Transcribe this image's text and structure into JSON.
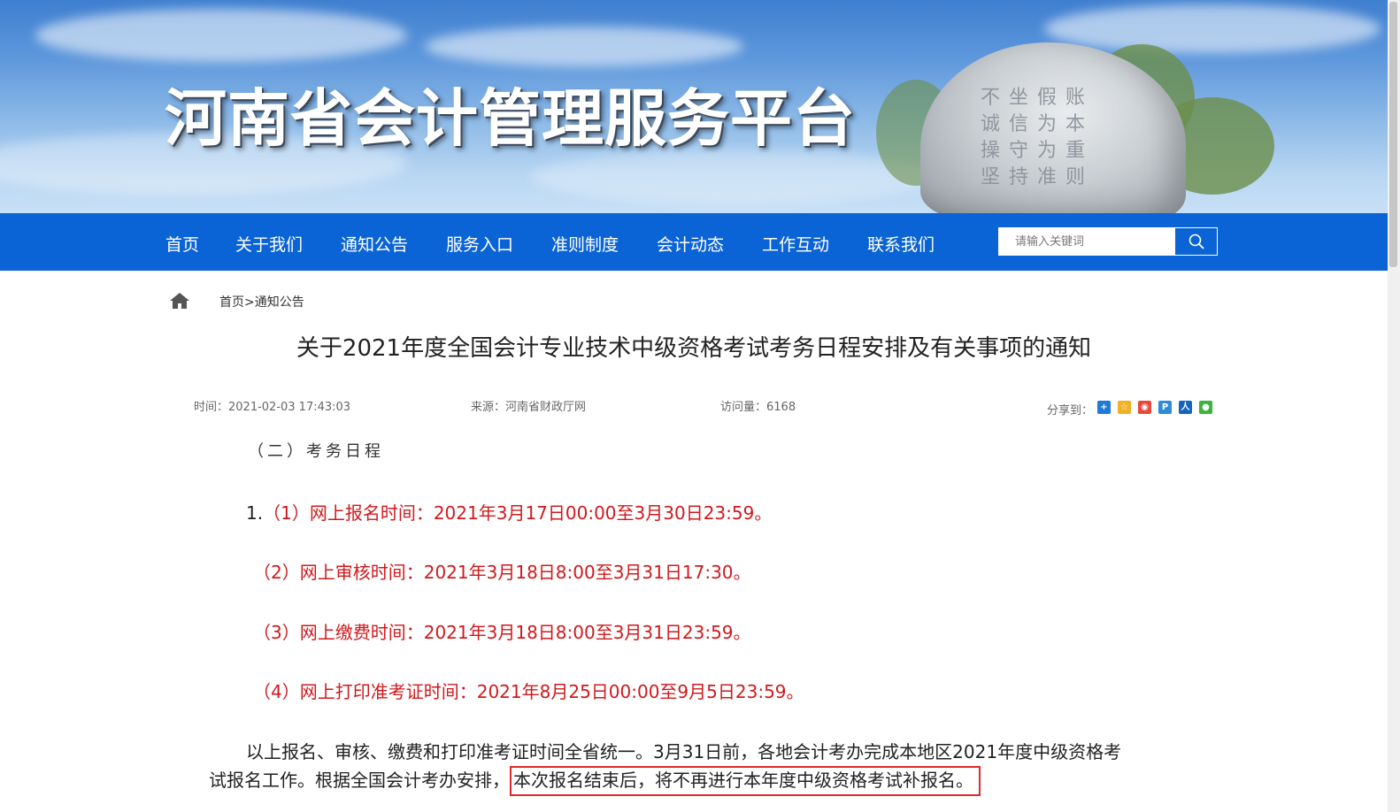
{
  "site": {
    "title": "河南省会计管理服务平台",
    "stone_inscription": "不坐假账诚信为本操守为重坚持准则"
  },
  "nav": {
    "items": [
      "首页",
      "关于我们",
      "通知公告",
      "服务入口",
      "准则制度",
      "会计动态",
      "工作互动",
      "联系我们"
    ]
  },
  "search": {
    "placeholder": "请输入关键词"
  },
  "breadcrumb": {
    "home": "首页",
    "separator": ">",
    "current": "通知公告"
  },
  "article": {
    "title": "关于2021年度全国会计专业技术中级资格考试考务日程安排及有关事项的通知",
    "time": "时间：2021-02-03 17:43:03",
    "source": "来源：河南省财政厅网",
    "views": "访问量：6168",
    "share_label": "分享到：",
    "share_icons": [
      "qzone-icon",
      "qq-icon",
      "weibo-icon",
      "pengyou-icon",
      "renren-icon",
      "wechat-icon"
    ],
    "section_heading": "（二）考务日程",
    "schedule": {
      "item_number": "1.",
      "lines": [
        "（1）网上报名时间：2021年3月17日00:00至3月30日23:59。",
        "（2）网上审核时间：2021年3月18日8:00至3月31日17:30。",
        "（3）网上缴费时间：2021年3月18日8:00至3月31日23:59。",
        "（4）网上打印准考证时间：2021年8月25日00:00至9月5日23:59。"
      ]
    },
    "paragraph": {
      "line1": "以上报名、审核、缴费和打印准考证时间全省统一。3月31日前，各地会计考办完成本地区2021年度中级资格考",
      "line2_prefix": "试报名工作。根据全国会计考办安排，",
      "line2_highlight": "本次报名结束后，将不再进行本年度中级资格考试补报名。"
    }
  },
  "colors": {
    "nav_bg": "#0b64d6",
    "schedule_text": "#d0191d",
    "highlight_border": "#e0282e"
  }
}
